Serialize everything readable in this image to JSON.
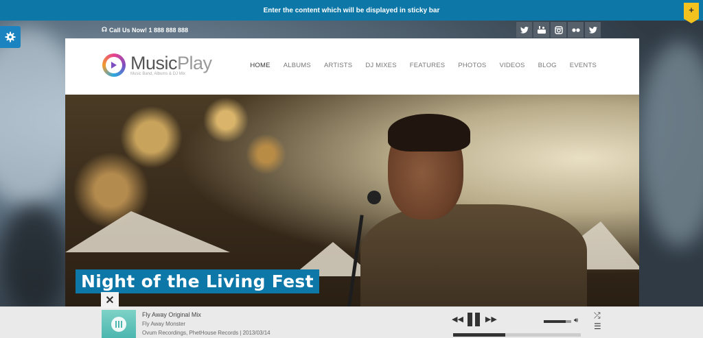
{
  "sticky_bar": {
    "text": "Enter the content which will be displayed in sticky bar",
    "toggle": "+"
  },
  "topbar": {
    "phone": "Call Us Now! 1 888 888 888"
  },
  "socials": [
    "twitter-icon",
    "youtube-icon",
    "instagram-icon",
    "flickr-icon",
    "twitter-icon"
  ],
  "brand": {
    "name_a": "Music",
    "name_b": "Play",
    "tagline": "Music Band, Albums & DJ Mix"
  },
  "nav": [
    "HOME",
    "ALBUMS",
    "ARTISTS",
    "DJ MIXES",
    "FEATURES",
    "PHOTOS",
    "VIDEOS",
    "BLOG",
    "EVENTS"
  ],
  "hero": {
    "title": "Night of the Living Fest"
  },
  "player": {
    "close": "✕",
    "track_title": "Fly Away Original Mix",
    "track_artist": "Fly Away Monster",
    "track_meta": "Ovum Recordings, PhetHouse Records | 2013/03/14",
    "progress": 0.41,
    "volume": 0.8
  },
  "colors": {
    "accent": "#0d77a8",
    "sticky_toggle": "#f4c21f"
  }
}
